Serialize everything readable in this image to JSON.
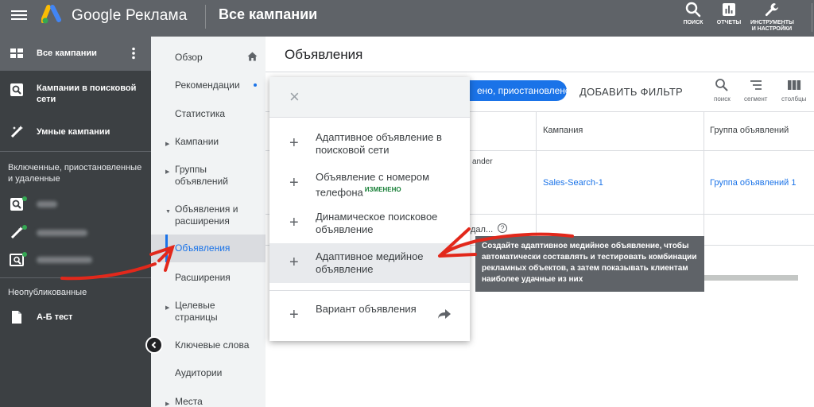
{
  "topbar": {
    "brand": "Google Реклама",
    "title": "Все кампании",
    "buttons": [
      {
        "label": "поиск",
        "icon": "search-icon"
      },
      {
        "label": "отчеты",
        "icon": "reports-icon"
      },
      {
        "label": "инструменты и настройки",
        "icon": "wrench-icon"
      }
    ]
  },
  "sidebar": {
    "all_campaigns": "Все кампании",
    "items": [
      {
        "label": "Кампании в поисковой сети",
        "icon": "search-campaign-icon"
      },
      {
        "label": "Умные кампании",
        "icon": "smart-campaign-icon"
      }
    ],
    "section_enabled": "Включенные, приостановленные и удаленные",
    "section_unpublished": "Неопубликованные",
    "draft": "А-Б тест"
  },
  "nav2": {
    "items": [
      {
        "label": "Обзор"
      },
      {
        "label": "Рекомендации"
      },
      {
        "label": "Статистика"
      },
      {
        "label": "Кампании"
      },
      {
        "label": "Группы объявлений"
      },
      {
        "label": "Объявления и расширения"
      },
      {
        "label": "Объявления"
      },
      {
        "label": "Расширения"
      },
      {
        "label": "Целевые страницы"
      },
      {
        "label": "Ключевые слова"
      },
      {
        "label": "Аудитории"
      },
      {
        "label": "Места"
      }
    ]
  },
  "main": {
    "title": "Объявления",
    "filter_chip": "ено, приостановлено",
    "add_filter": "ДОБАВИТЬ ФИЛЬТР",
    "tools": [
      {
        "label": "поиск",
        "icon": "search-icon"
      },
      {
        "label": "сегмент",
        "icon": "segment-icon"
      },
      {
        "label": "столбцы",
        "icon": "columns-icon"
      }
    ],
    "columns": {
      "campaign": "Кампания",
      "ad_group": "Группа объявлений"
    },
    "row1": {
      "partial_text": "ander",
      "campaign": "Sales-Search-1",
      "ad_group": "Группа объявлений 1"
    },
    "row2": {
      "partial_text": "дал...",
      "help": "?"
    }
  },
  "menu": {
    "close": "×",
    "items": [
      {
        "label": "Адаптивное объявление в поисковой сети",
        "badge": ""
      },
      {
        "label": "Объявление с номером телефона",
        "badge": "ИЗМЕНЕНО"
      },
      {
        "label": "Динамическое поисковое объявление",
        "badge": ""
      },
      {
        "label": "Адаптивное медийное объявление",
        "badge": ""
      }
    ],
    "variant": "Вариант объявления",
    "plus": "+"
  },
  "tooltip": {
    "text": "Создайте адаптивное медийное объявление, чтобы автоматически составлять и тестировать комбинации рекламных объектов, а затем показывать клиентам наиболее удачные из них"
  },
  "colors": {
    "topbar": "#5f6368",
    "sidebar": "#3c4043",
    "accent": "#1a73e8",
    "annotation": "#e2281b",
    "badge_green": "#188038"
  }
}
